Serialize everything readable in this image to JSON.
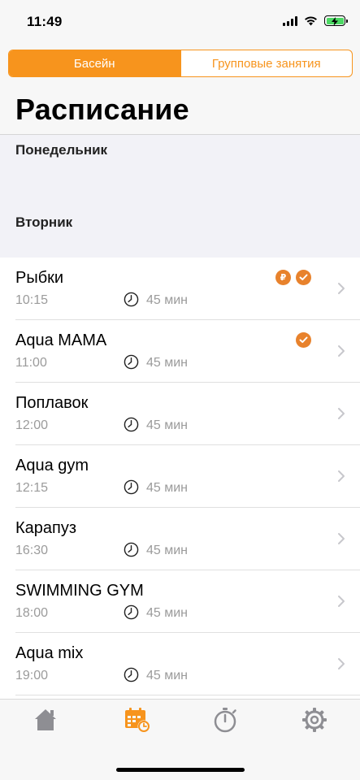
{
  "status_bar": {
    "time": "11:49"
  },
  "segmented_control": {
    "items": [
      {
        "label": "Басейн",
        "active": true
      },
      {
        "label": "Групповые занятия",
        "active": false
      }
    ]
  },
  "page_title": "Расписание",
  "days": [
    {
      "label": "Понедельник"
    },
    {
      "label": "Вторник"
    }
  ],
  "schedule": [
    {
      "title": "Рыбки",
      "time": "10:15",
      "duration": "45 мин",
      "badges": [
        "ruble-badge-icon",
        "checkmark-badge-icon"
      ],
      "ruble_symbol": "₽"
    },
    {
      "title": "Aqua MAMA",
      "time": "11:00",
      "duration": "45 мин",
      "badges": [
        "checkmark-badge-icon"
      ]
    },
    {
      "title": "Поплавок",
      "time": "12:00",
      "duration": "45 мин",
      "badges": []
    },
    {
      "title": "Aqua gym",
      "time": "12:15",
      "duration": "45 мин",
      "badges": []
    },
    {
      "title": "Карапуз",
      "time": "16:30",
      "duration": "45 мин",
      "badges": []
    },
    {
      "title": "SWIMMING GYM",
      "time": "18:00",
      "duration": "45 мин",
      "badges": []
    },
    {
      "title": "Aqua mix",
      "time": "19:00",
      "duration": "45 мин",
      "badges": []
    }
  ],
  "tab_bar": {
    "items": [
      {
        "icon": "home-icon",
        "active": false
      },
      {
        "icon": "calendar-clock-icon",
        "active": true
      },
      {
        "icon": "stopwatch-icon",
        "active": false
      },
      {
        "icon": "gear-icon",
        "active": false
      }
    ]
  },
  "colors": {
    "accent": "#f7941d",
    "badge": "#e8822c",
    "inactive_tab": "#8e8e93",
    "secondary_text": "#9b9b9b"
  }
}
